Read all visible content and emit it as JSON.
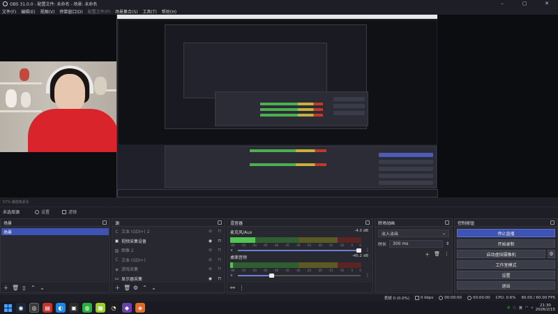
{
  "window": {
    "title": "OBS 31.0.0 - 配置文件: 未命名 - 场景: 未命名",
    "controls": [
      "–",
      "▢",
      "✕"
    ]
  },
  "menu": [
    {
      "label": "文件(F)",
      "enabled": true
    },
    {
      "label": "编辑(E)",
      "enabled": true
    },
    {
      "label": "视图(V)",
      "enabled": true
    },
    {
      "label": "停靠窗口(D)",
      "enabled": true
    },
    {
      "label": "配置文件(P)",
      "enabled": false
    },
    {
      "label": "场景集合(S)",
      "enabled": true
    },
    {
      "label": "工具(T)",
      "enabled": true
    },
    {
      "label": "帮助(H)",
      "enabled": true
    }
  ],
  "preview": {
    "zoom_text": "57%    播放像素化"
  },
  "toolbar": {
    "no_source": "未选择源",
    "properties": "设置",
    "filters": "滤镜"
  },
  "scenes": {
    "title": "场景",
    "items": [
      "场景"
    ],
    "footer_icons": [
      "＋",
      "🗑",
      "▯",
      "⌃",
      "⌄"
    ]
  },
  "sources": {
    "title": "源",
    "items": [
      {
        "label": "文本 (GDI+) 2",
        "icon": "text-icon",
        "visible": false,
        "dim": true
      },
      {
        "label": "视频采集设备",
        "icon": "camera-icon",
        "visible": true,
        "dim": false
      },
      {
        "label": "图像 2",
        "icon": "image-icon",
        "visible": false,
        "dim": true
      },
      {
        "label": "文本 (GDI+)",
        "icon": "text-icon",
        "visible": false,
        "dim": true
      },
      {
        "label": "游戏采集",
        "icon": "game-icon",
        "visible": false,
        "dim": true
      },
      {
        "label": "显示器采集",
        "icon": "monitor-icon",
        "visible": true,
        "dim": false
      }
    ],
    "footer_icons": [
      "＋",
      "🗑",
      "⚙",
      "⌃",
      "⌄"
    ]
  },
  "mixer": {
    "title": "混音器",
    "channels": [
      {
        "name": "麦克风/Aux",
        "db": "-4.0 dB",
        "level": 0.19,
        "volume": 0.99
      },
      {
        "name": "桌面音频",
        "db": "-45.2 dB",
        "level": 0.02,
        "volume": 0.28
      }
    ],
    "ticks": [
      "-60",
      "-55",
      "-50",
      "-45",
      "-40",
      "-35",
      "-30",
      "-25",
      "-20",
      "-15",
      "-10",
      "-5",
      "0"
    ]
  },
  "transitions": {
    "title": "转场动画",
    "selected": "淡入淡出",
    "duration_label": "时长",
    "duration_value": "300 ms"
  },
  "controls": {
    "title": "控制按钮",
    "stop_stream": "停止直播",
    "start_record": "开始录制",
    "virtual_cam": "启动虚拟摄像机",
    "studio_mode": "工作室模式",
    "settings": "设置",
    "exit": "退出"
  },
  "status": {
    "dropped": "丢帧 0 (0.0%)",
    "kbps": "0 kbps",
    "rec_time": "00:00:00",
    "stream_time": "00:00:00",
    "cpu": "CPU: 0.6%",
    "fps": "60.00 / 60.00 FPS"
  },
  "taskbar": {
    "time": "21:30",
    "date": "2026/2/15",
    "lang": "英"
  }
}
